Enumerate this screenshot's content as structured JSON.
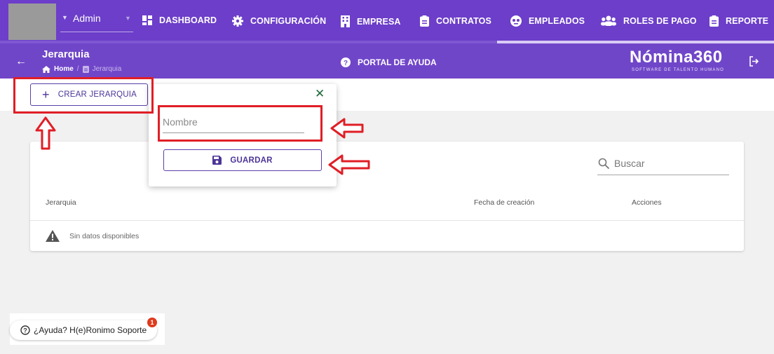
{
  "topnav": {
    "user": "Admin",
    "items": [
      {
        "label": "DASHBOARD",
        "icon": "dashboard-icon"
      },
      {
        "label": "CONFIGURACIÓN",
        "icon": "gear-icon"
      },
      {
        "label": "EMPRESA",
        "icon": "building-icon"
      },
      {
        "label": "CONTRATOS",
        "icon": "clipboard-icon"
      },
      {
        "label": "EMPLEADOS",
        "icon": "globe-icon"
      },
      {
        "label": "ROLES DE PAGO",
        "icon": "users-icon"
      },
      {
        "label": "REPORTE",
        "icon": "clipboard-icon"
      }
    ],
    "colors": {
      "primary": "#6c3ec9",
      "secondary": "#7046c9",
      "highlight": "#e01e26"
    }
  },
  "header": {
    "title": "Jerarquia",
    "breadcrumb_home": "Home",
    "breadcrumb_sep": "/",
    "breadcrumb_current": "Jerarquia",
    "help_portal": "PORTAL DE AYUDA",
    "brand": "Nómina360",
    "tagline": "SOFTWARE DE TALENTO HUMANO"
  },
  "actions": {
    "create_label": "CREAR JERARQUIA"
  },
  "popover": {
    "name_placeholder": "Nombre",
    "save_label": "GUARDAR"
  },
  "table": {
    "search_label": "Buscar",
    "columns": [
      "Jerarquia",
      "Fecha de creación",
      "Acciones"
    ],
    "empty_text": "Sin datos disponibles"
  },
  "help_widget": {
    "label": "¿Ayuda? H(e)Ronimo Soporte",
    "badge": "1"
  }
}
